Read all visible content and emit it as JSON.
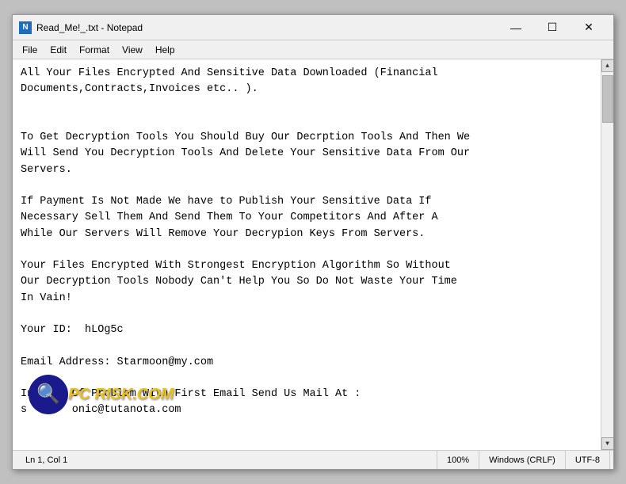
{
  "window": {
    "title": "Read_Me!_.txt - Notepad",
    "icon_label": "N"
  },
  "title_bar_buttons": {
    "minimize": "—",
    "maximize": "☐",
    "close": "✕"
  },
  "menu": {
    "items": [
      "File",
      "Edit",
      "Format",
      "View",
      "Help"
    ]
  },
  "content": {
    "text": "All Your Files Encrypted And Sensitive Data Downloaded (Financial\nDocuments,Contracts,Invoices etc.. ).\n\n\nTo Get Decryption Tools You Should Buy Our Decrption Tools And Then We\nWill Send You Decryption Tools And Delete Your Sensitive Data From Our\nServers.\n\nIf Payment Is Not Made We have to Publish Your Sensitive Data If\nNecessary Sell Them And Send Them To Your Competitors And After A\nWhile Our Servers Will Remove Your Decrypion Keys From Servers.\n\nYour Files Encrypted With Strongest Encryption Algorithm So Without\nOur Decryption Tools Nobody Can't Help You So Do Not Waste Your Time\nIn Vain!\n\nYour ID:  hLOg5c\n\nEmail Address: Starmoon@my.com\n\nIn Case Of Problem With First Email Send Us Mail At :\ns       onic@tutanota.com"
  },
  "status_bar": {
    "position": "Ln 1, Col 1",
    "zoom": "100%",
    "line_ending": "Windows (CRLF)",
    "encoding": "UTF-8"
  },
  "watermark": {
    "text": "PC RISK.COM"
  }
}
